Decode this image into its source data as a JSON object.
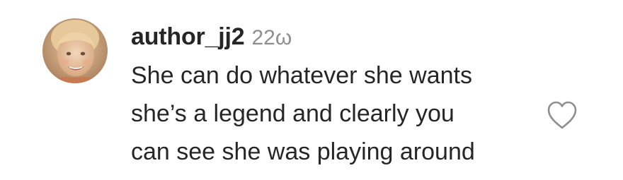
{
  "comment": {
    "username": "author_jj2",
    "time": "22ω",
    "text": "She can do whatever she wants\nshe’s a legend and clearly you\ncan see she was playing around"
  },
  "icons": {
    "like": "heart-outline-icon",
    "avatar": "profile-photo"
  },
  "colors": {
    "username": "#262626",
    "time": "#8e8e8e",
    "text": "#262626",
    "heart": "#8e8e8e"
  }
}
